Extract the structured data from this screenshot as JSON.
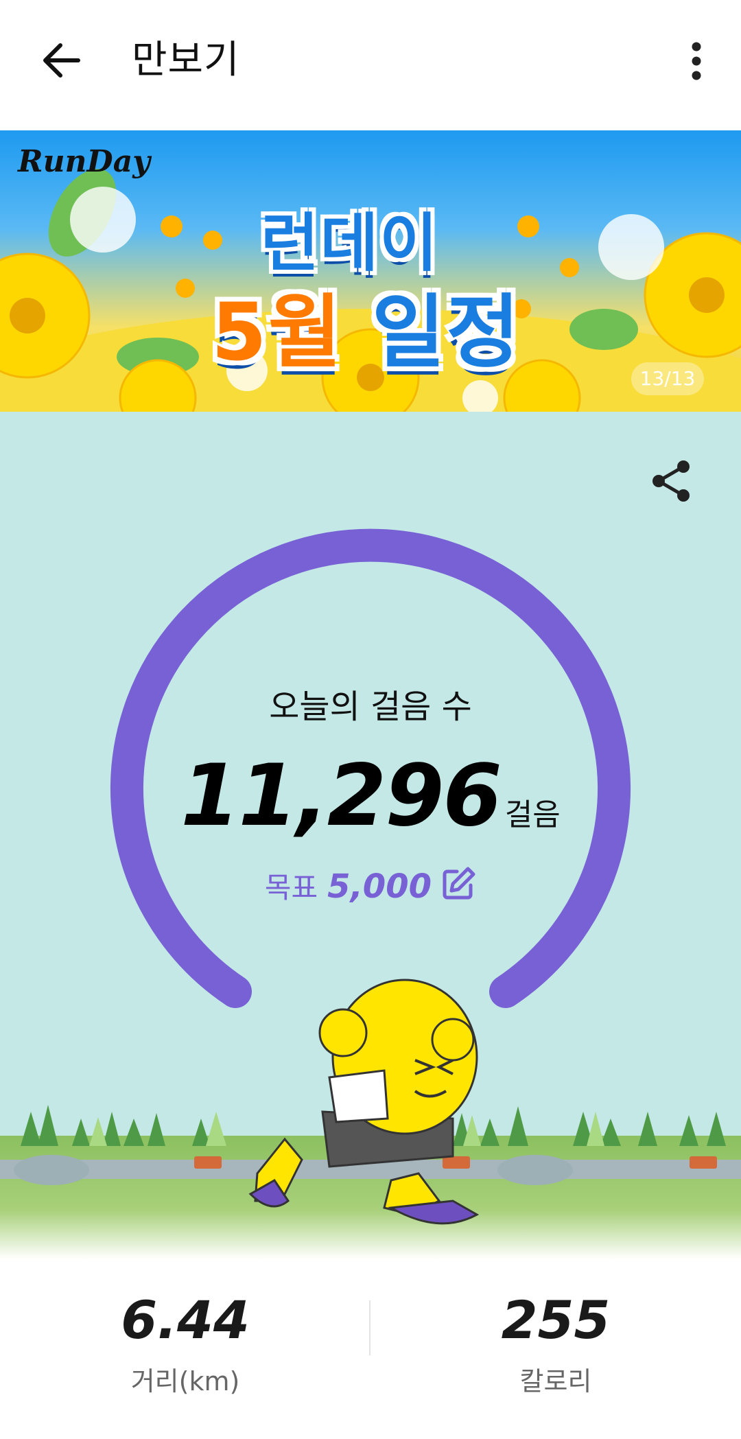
{
  "header": {
    "title": "만보기",
    "back_icon": "arrow-left-icon",
    "menu_icon": "more-vert-icon"
  },
  "banner": {
    "brand": "RunDay",
    "line1": "런데이",
    "line2_highlight": "5월",
    "line2_rest": " 일정",
    "pager": "13/13"
  },
  "today": {
    "label": "오늘의 걸음 수",
    "steps": "11,296",
    "unit": "걸음",
    "goal_label": "목표",
    "goal_value": "5,000",
    "progress_fraction": 1.0,
    "share_icon": "share-icon",
    "edit_icon": "edit-icon"
  },
  "stats": {
    "distance_value": "6.44",
    "distance_label": "거리(km)",
    "calorie_value": "255",
    "calorie_label": "칼로리"
  },
  "colors": {
    "accent": "#7761d5",
    "card_bg": "#c3e8e6",
    "banner_blue": "#1a7de0",
    "banner_orange": "#ff7a00"
  }
}
